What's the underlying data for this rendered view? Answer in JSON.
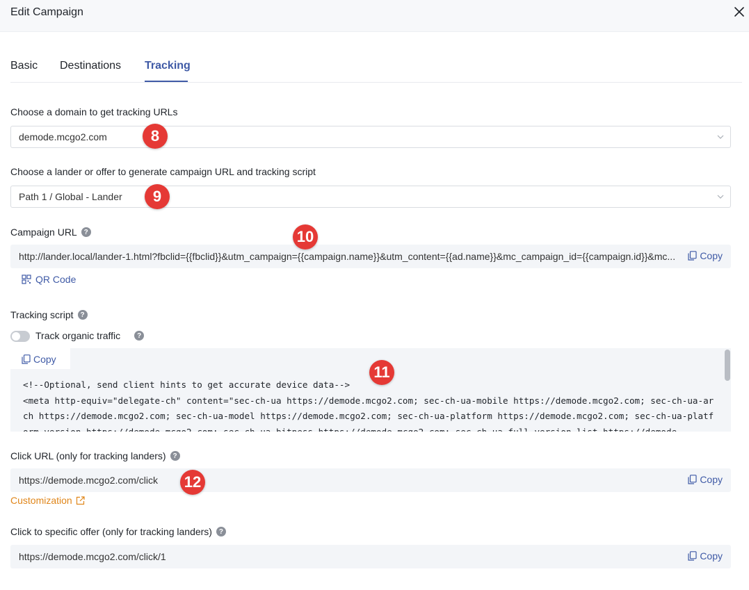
{
  "header": {
    "title": "Edit Campaign"
  },
  "tabs": [
    {
      "label": "Basic"
    },
    {
      "label": "Destinations"
    },
    {
      "label": "Tracking"
    }
  ],
  "domain": {
    "label": "Choose a domain to get tracking URLs",
    "value": "demode.mcgo2.com"
  },
  "lander": {
    "label": "Choose a lander or offer to generate campaign URL and tracking script",
    "value": "Path 1 / Global - Lander"
  },
  "campaign_url": {
    "label": "Campaign URL",
    "value": "http://lander.local/lander-1.html?fbclid={{fbclid}}&utm_campaign={{campaign.name}}&utm_content={{ad.name}}&mc_campaign_id={{campaign.id}}&mc...",
    "copy_label": "Copy",
    "qr_label": "QR Code"
  },
  "tracking_script": {
    "label": "Tracking script",
    "toggle_label": "Track organic traffic",
    "copy_label": "Copy",
    "code": "<!--Optional, send client hints to get accurate device data-->\n<meta http-equiv=\"delegate-ch\" content=\"sec-ch-ua https://demode.mcgo2.com; sec-ch-ua-mobile https://demode.mcgo2.com; sec-ch-ua-arch https://demode.mcgo2.com; sec-ch-ua-model https://demode.mcgo2.com; sec-ch-ua-platform https://demode.mcgo2.com; sec-ch-ua-platform-version https://demode.mcgo2.com; sec-ch-ua-bitness https://demode.mcgo2.com; sec-ch-ua-full-version-list https://demode."
  },
  "click_url": {
    "label": "Click URL (only for tracking landers)",
    "value": "https://demode.mcgo2.com/click",
    "copy_label": "Copy",
    "customization_label": "Customization"
  },
  "offer_click_url": {
    "label": "Click to specific offer (only for tracking landers)",
    "value": "https://demode.mcgo2.com/click/1",
    "copy_label": "Copy"
  },
  "badges": [
    "8",
    "9",
    "10",
    "11",
    "12"
  ],
  "colors": {
    "accent": "#3f5aa6",
    "customization": "#e0861a",
    "badge": "#e53935",
    "field_bg": "#f3f5f8"
  }
}
